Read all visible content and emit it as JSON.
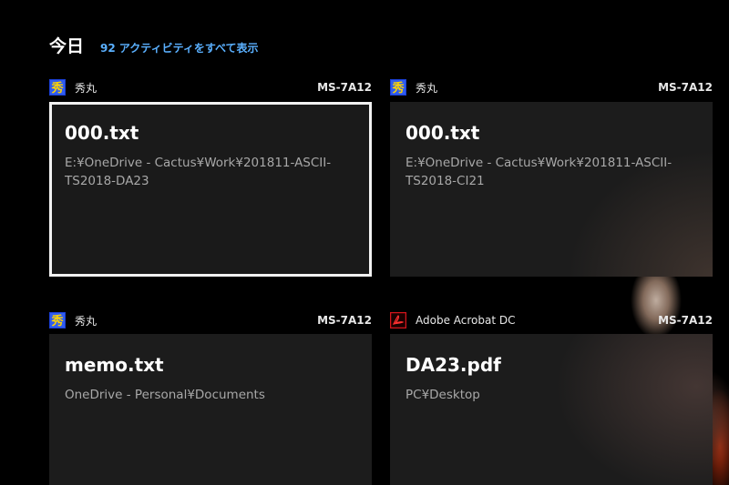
{
  "header": {
    "title": "今日",
    "activity_link": "92 アクティビティをすべて表示"
  },
  "cards": [
    {
      "app_icon": "hidemaru-icon",
      "app_name": "秀丸",
      "device": "MS-7A12",
      "file_name": "000.txt",
      "path": "E:¥OneDrive - Cactus¥Work¥201811-ASCII-TS2018-DA23",
      "selected": true
    },
    {
      "app_icon": "hidemaru-icon",
      "app_name": "秀丸",
      "device": "MS-7A12",
      "file_name": "000.txt",
      "path": "E:¥OneDrive - Cactus¥Work¥201811-ASCII-TS2018-CI21",
      "selected": false
    },
    {
      "app_icon": "hidemaru-icon",
      "app_name": "秀丸",
      "device": "MS-7A12",
      "file_name": "memo.txt",
      "path": "OneDrive - Personal¥Documents",
      "selected": false
    },
    {
      "app_icon": "acrobat-icon",
      "app_name": "Adobe Acrobat DC",
      "device": "MS-7A12",
      "file_name": "DA23.pdf",
      "path": "PC¥Desktop",
      "selected": false
    }
  ],
  "colors": {
    "background": "#000000",
    "card": "#1c1c1c",
    "link": "#5ab0ff",
    "path_text": "#a8a8a8",
    "acrobat_red": "#d4141b"
  }
}
